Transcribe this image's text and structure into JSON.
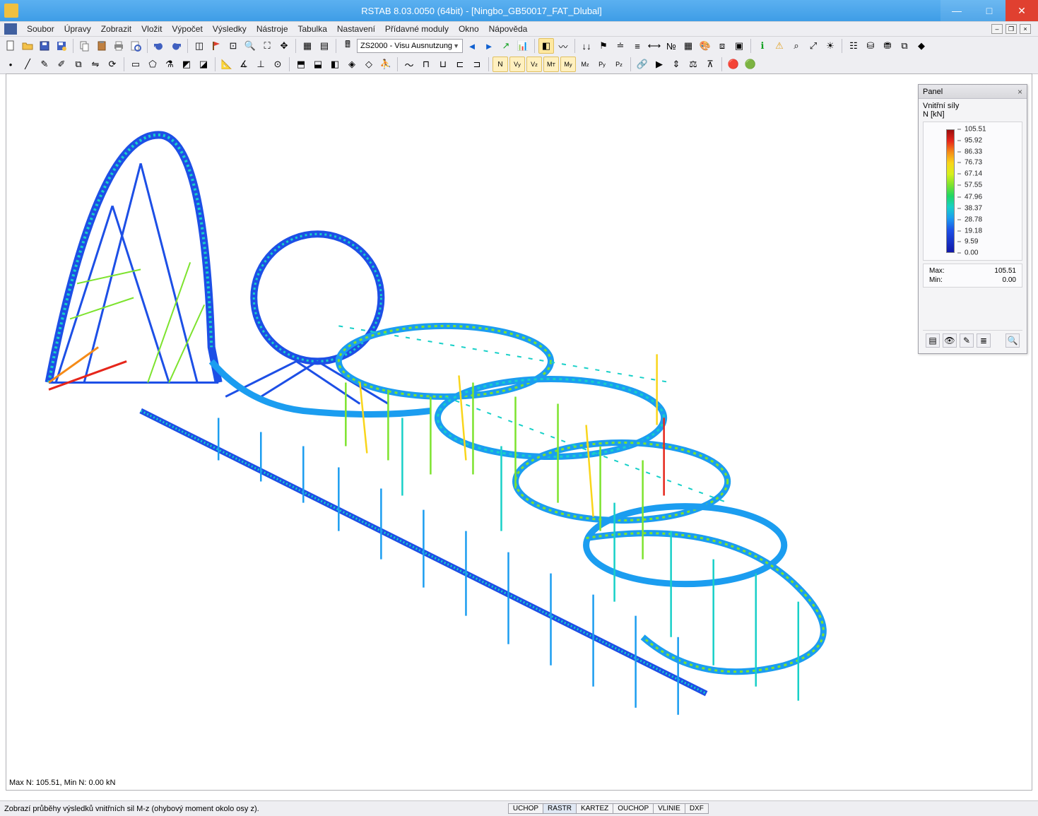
{
  "title": "RSTAB 8.03.0050 (64bit) - [Ningbo_GB50017_FAT_Dlubal]",
  "menu": [
    "Soubor",
    "Úpravy",
    "Zobrazit",
    "Vložit",
    "Výpočet",
    "Výsledky",
    "Nástroje",
    "Tabulka",
    "Nastavení",
    "Přídavné moduly",
    "Okno",
    "Nápověda"
  ],
  "combo_value": "ZS2000 - Visu Ausnutzung",
  "panel": {
    "title": "Panel",
    "heading1": "Vnitřní síly",
    "heading2": "N [kN]",
    "scale": [
      "105.51",
      "95.92",
      "86.33",
      "76.73",
      "67.14",
      "57.55",
      "47.96",
      "38.37",
      "28.78",
      "19.18",
      "9.59",
      "0.00"
    ],
    "max_label": "Max:",
    "max_value": "105.51",
    "min_label": "Min:",
    "min_value": "0.00"
  },
  "viewport_info": "Max N: 105.51, Min N: 0.00 kN",
  "status_msg": "Zobrazí průběhy výsledků vnitřních sil M-z (ohybový moment okolo osy z).",
  "status_tabs": [
    "UCHOP",
    "RASTR",
    "KARTEZ",
    "OUCHOP",
    "VLINIE",
    "DXF"
  ],
  "status_active": 1,
  "chart_data": {
    "type": "colorscale",
    "title": "Vnitřní síly N [kN]",
    "values": [
      105.51,
      95.92,
      86.33,
      76.73,
      67.14,
      57.55,
      47.96,
      38.37,
      28.78,
      19.18,
      9.59,
      0.0
    ],
    "colors": [
      "#9b0d0d",
      "#e6261b",
      "#f07018",
      "#f5a818",
      "#f9d51b",
      "#c8ea1c",
      "#7de32e",
      "#1fd764",
      "#18d0c8",
      "#1b9df0",
      "#1d4fe6",
      "#1118a8"
    ],
    "max": 105.51,
    "min": 0.0,
    "unit": "kN"
  }
}
